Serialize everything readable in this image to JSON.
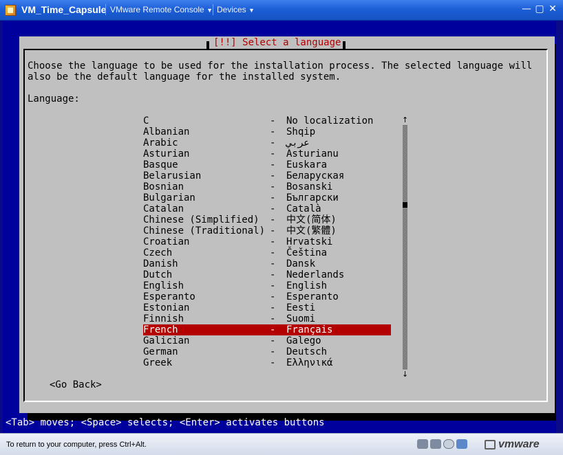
{
  "window": {
    "title": "VM_Time_Capsule",
    "console_menu": "VMware Remote Console",
    "devices_menu": "Devices",
    "buttons": {
      "minimize": "—",
      "maximize": "▢",
      "close": "✕"
    }
  },
  "dialog": {
    "title": "[!!] Select a language",
    "prompt_line1": "Choose the language to be used for the installation process. The selected language will",
    "prompt_line2": "also be the default language for the installed system.",
    "label": "Language:",
    "go_back": "<Go Back>",
    "selected_language": "French",
    "languages": [
      {
        "name": "C",
        "native": "No localization"
      },
      {
        "name": "Albanian",
        "native": "Shqip"
      },
      {
        "name": "Arabic",
        "native": "عربي"
      },
      {
        "name": "Asturian",
        "native": "Asturianu"
      },
      {
        "name": "Basque",
        "native": "Euskara"
      },
      {
        "name": "Belarusian",
        "native": "Беларуская"
      },
      {
        "name": "Bosnian",
        "native": "Bosanski"
      },
      {
        "name": "Bulgarian",
        "native": "Български"
      },
      {
        "name": "Catalan",
        "native": "Català"
      },
      {
        "name": "Chinese (Simplified)",
        "native": "中文(简体)"
      },
      {
        "name": "Chinese (Traditional)",
        "native": "中文(繁體)"
      },
      {
        "name": "Croatian",
        "native": "Hrvatski"
      },
      {
        "name": "Czech",
        "native": "Čeština"
      },
      {
        "name": "Danish",
        "native": "Dansk"
      },
      {
        "name": "Dutch",
        "native": "Nederlands"
      },
      {
        "name": "English",
        "native": "English"
      },
      {
        "name": "Esperanto",
        "native": "Esperanto"
      },
      {
        "name": "Estonian",
        "native": "Eesti"
      },
      {
        "name": "Finnish",
        "native": "Suomi"
      },
      {
        "name": "French",
        "native": "Français"
      },
      {
        "name": "Galician",
        "native": "Galego"
      },
      {
        "name": "German",
        "native": "Deutsch"
      },
      {
        "name": "Greek",
        "native": "Ελληνικά"
      }
    ],
    "separator": "-",
    "scroll_up": "↑",
    "scroll_down": "↓"
  },
  "help_bar": "<Tab> moves; <Space> selects; <Enter> activates buttons",
  "statusbar": {
    "text": "To return to your computer, press Ctrl+Alt.",
    "brand": "vmware"
  },
  "colors": {
    "console_bg": "#00009c",
    "dialog_bg": "#c0c0c0",
    "selection": "#b30000",
    "title_red": "#b00000"
  }
}
